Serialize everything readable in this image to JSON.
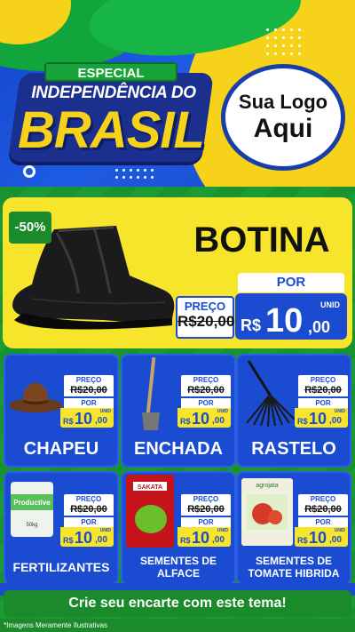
{
  "header": {
    "badge": "ESPECIAL",
    "title_line1": "INDEPENDÊNCIA DO",
    "title_line2": "BRASIL",
    "logo_line1": "Sua Logo",
    "logo_line2": "Aqui"
  },
  "hero": {
    "discount": "-50%",
    "name": "BOTINA",
    "price_label": "PREÇO",
    "old_price": "R$20,00",
    "por_label": "POR",
    "unit": "UNID",
    "currency": "R$",
    "price_int": "10",
    "price_dec": ",00"
  },
  "products": [
    {
      "name": "CHAPEU",
      "price_label": "PREÇO",
      "old_price": "R$20,00",
      "por_label": "POR",
      "unit": "UNID",
      "currency": "R$",
      "price_int": "10",
      "price_dec": ",00"
    },
    {
      "name": "ENCHADA",
      "price_label": "PREÇO",
      "old_price": "R$20,00",
      "por_label": "POR",
      "unit": "UNID",
      "currency": "R$",
      "price_int": "10",
      "price_dec": ",00"
    },
    {
      "name": "RASTELO",
      "price_label": "PREÇO",
      "old_price": "R$20,00",
      "por_label": "POR",
      "unit": "UNID",
      "currency": "R$",
      "price_int": "10",
      "price_dec": ",00"
    },
    {
      "name": "FERTILIZANTES",
      "price_label": "PREÇO",
      "old_price": "R$20,00",
      "por_label": "POR",
      "unit": "UNID",
      "currency": "R$",
      "price_int": "10",
      "price_dec": ",00",
      "package_text": "Productive",
      "package_weight": "50kg"
    },
    {
      "name_line1": "SEMENTES DE",
      "name_line2": "ALFACE",
      "price_label": "PREÇO",
      "old_price": "R$20,00",
      "por_label": "POR",
      "unit": "UNID",
      "currency": "R$",
      "price_int": "10",
      "price_dec": ",00",
      "package_brand": "SAKATA"
    },
    {
      "name_line1": "SEMENTES DE",
      "name_line2": "TOMATE HIBRIDA",
      "price_label": "PREÇO",
      "old_price": "R$20,00",
      "por_label": "POR",
      "unit": "UNID",
      "currency": "R$",
      "price_int": "10",
      "price_dec": ",00",
      "package_brand": "agrojata"
    }
  ],
  "cta": "Crie seu encarte com este tema!",
  "footnote": "*Imagens Meramente Ilustrativas",
  "colors": {
    "blue": "#1a4bd1",
    "green": "#1a8a2a",
    "yellow": "#f6e52a"
  }
}
